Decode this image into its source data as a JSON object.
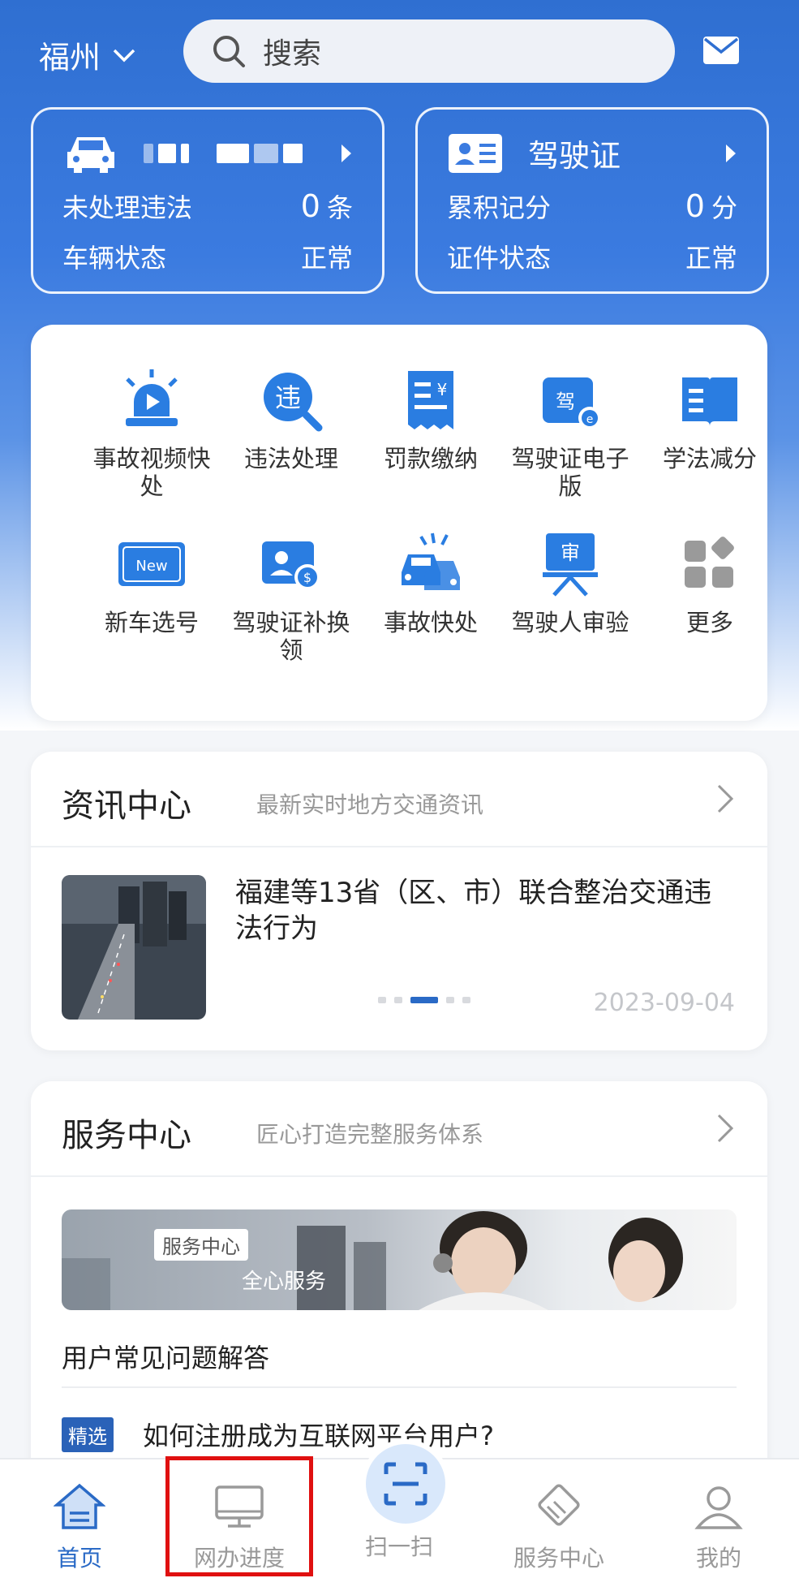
{
  "header": {
    "city": "福州",
    "search_placeholder": "搜索"
  },
  "vehicle_card": {
    "violations_label": "未处理违法",
    "violations_count": "0",
    "violations_unit": "条",
    "status_label": "车辆状态",
    "status_value": "正常"
  },
  "license_card": {
    "title": "驾驶证",
    "points_label": "累积记分",
    "points_value": "0",
    "points_unit": "分",
    "status_label": "证件状态",
    "status_value": "正常"
  },
  "quick_actions": [
    {
      "label": "事故视频快处",
      "icon": "police-light-icon"
    },
    {
      "label": "违法处理",
      "icon": "violation-search-icon"
    },
    {
      "label": "罚款缴纳",
      "icon": "receipt-yuan-icon"
    },
    {
      "label": "驾驶证电子版",
      "icon": "e-license-icon"
    },
    {
      "label": "学法减分",
      "icon": "book-icon"
    },
    {
      "label": "新车选号",
      "icon": "new-plate-icon"
    },
    {
      "label": "驾驶证补换领",
      "icon": "license-renew-icon"
    },
    {
      "label": "事故快处",
      "icon": "car-crash-icon"
    },
    {
      "label": "驾驶人审验",
      "icon": "review-icon"
    },
    {
      "label": "更多",
      "icon": "grid-more-icon"
    }
  ],
  "news": {
    "title": "资讯中心",
    "subtitle": "最新实时地方交通资讯",
    "headline": "福建等13省（区、市）联合整治交通违法行为",
    "date": "2023-09-04",
    "dots_total": 5,
    "dots_active": 3
  },
  "service": {
    "title": "服务中心",
    "subtitle": "匠心打造完整服务体系",
    "banner_tag": "服务中心",
    "banner_text": "全心服务",
    "faq_title": "用户常见问题解答",
    "faq_badge": "精选",
    "faq_question": "如何注册成为互联网平台用户?"
  },
  "tabbar": {
    "home": "首页",
    "progress": "网办进度",
    "scan": "扫一扫",
    "service": "服务中心",
    "mine": "我的"
  },
  "colors": {
    "brand_blue": "#2f6fd1",
    "icon_blue": "#2a7de1",
    "highlight_red": "#e01010"
  }
}
